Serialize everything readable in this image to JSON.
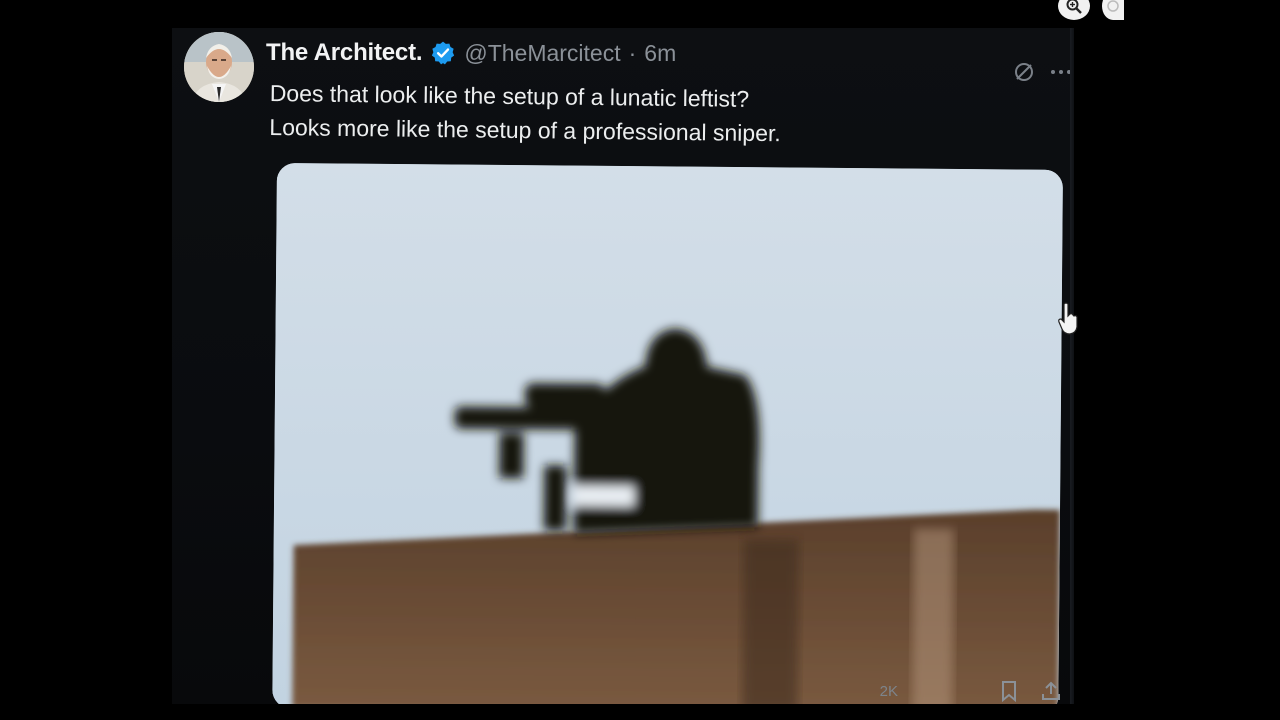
{
  "post": {
    "author_name": "The Architect.",
    "handle": "@TheMarcitect",
    "separator": "·",
    "time": "6m",
    "text_lines": [
      "Does that look like the setup of a lunatic leftist?",
      "Looks more like the setup of a professional sniper."
    ],
    "views": "2K"
  },
  "icons": {
    "verified": "verified-badge-icon",
    "grok": "grok-icon",
    "more": "more-icon",
    "bookmark": "bookmark-icon",
    "share": "share-icon",
    "zoom": "zoom-icon",
    "cursor": "hand-cursor-icon"
  },
  "colors": {
    "background": "#0d0f12",
    "verified_blue": "#1d9bf0",
    "muted_text": "#8b9198",
    "sky": "#c9d8e4",
    "wall": "#6e4f36"
  }
}
